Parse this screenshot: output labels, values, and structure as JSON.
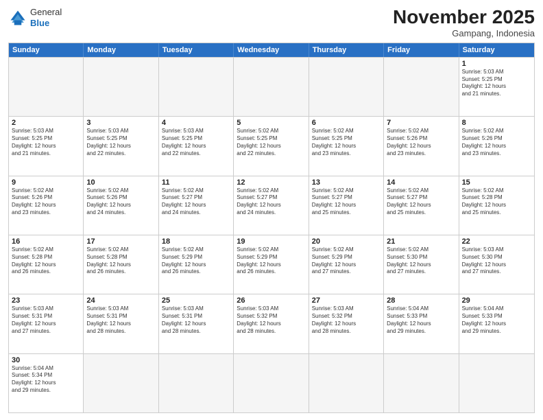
{
  "header": {
    "logo_general": "General",
    "logo_blue": "Blue",
    "month_title": "November 2025",
    "location": "Gampang, Indonesia"
  },
  "weekdays": [
    "Sunday",
    "Monday",
    "Tuesday",
    "Wednesday",
    "Thursday",
    "Friday",
    "Saturday"
  ],
  "rows": [
    [
      {
        "day": "",
        "text": ""
      },
      {
        "day": "",
        "text": ""
      },
      {
        "day": "",
        "text": ""
      },
      {
        "day": "",
        "text": ""
      },
      {
        "day": "",
        "text": ""
      },
      {
        "day": "",
        "text": ""
      },
      {
        "day": "1",
        "text": "Sunrise: 5:03 AM\nSunset: 5:25 PM\nDaylight: 12 hours\nand 21 minutes."
      }
    ],
    [
      {
        "day": "2",
        "text": "Sunrise: 5:03 AM\nSunset: 5:25 PM\nDaylight: 12 hours\nand 21 minutes."
      },
      {
        "day": "3",
        "text": "Sunrise: 5:03 AM\nSunset: 5:25 PM\nDaylight: 12 hours\nand 22 minutes."
      },
      {
        "day": "4",
        "text": "Sunrise: 5:03 AM\nSunset: 5:25 PM\nDaylight: 12 hours\nand 22 minutes."
      },
      {
        "day": "5",
        "text": "Sunrise: 5:02 AM\nSunset: 5:25 PM\nDaylight: 12 hours\nand 22 minutes."
      },
      {
        "day": "6",
        "text": "Sunrise: 5:02 AM\nSunset: 5:25 PM\nDaylight: 12 hours\nand 23 minutes."
      },
      {
        "day": "7",
        "text": "Sunrise: 5:02 AM\nSunset: 5:26 PM\nDaylight: 12 hours\nand 23 minutes."
      },
      {
        "day": "8",
        "text": "Sunrise: 5:02 AM\nSunset: 5:26 PM\nDaylight: 12 hours\nand 23 minutes."
      }
    ],
    [
      {
        "day": "9",
        "text": "Sunrise: 5:02 AM\nSunset: 5:26 PM\nDaylight: 12 hours\nand 23 minutes."
      },
      {
        "day": "10",
        "text": "Sunrise: 5:02 AM\nSunset: 5:26 PM\nDaylight: 12 hours\nand 24 minutes."
      },
      {
        "day": "11",
        "text": "Sunrise: 5:02 AM\nSunset: 5:27 PM\nDaylight: 12 hours\nand 24 minutes."
      },
      {
        "day": "12",
        "text": "Sunrise: 5:02 AM\nSunset: 5:27 PM\nDaylight: 12 hours\nand 24 minutes."
      },
      {
        "day": "13",
        "text": "Sunrise: 5:02 AM\nSunset: 5:27 PM\nDaylight: 12 hours\nand 25 minutes."
      },
      {
        "day": "14",
        "text": "Sunrise: 5:02 AM\nSunset: 5:27 PM\nDaylight: 12 hours\nand 25 minutes."
      },
      {
        "day": "15",
        "text": "Sunrise: 5:02 AM\nSunset: 5:28 PM\nDaylight: 12 hours\nand 25 minutes."
      }
    ],
    [
      {
        "day": "16",
        "text": "Sunrise: 5:02 AM\nSunset: 5:28 PM\nDaylight: 12 hours\nand 26 minutes."
      },
      {
        "day": "17",
        "text": "Sunrise: 5:02 AM\nSunset: 5:28 PM\nDaylight: 12 hours\nand 26 minutes."
      },
      {
        "day": "18",
        "text": "Sunrise: 5:02 AM\nSunset: 5:29 PM\nDaylight: 12 hours\nand 26 minutes."
      },
      {
        "day": "19",
        "text": "Sunrise: 5:02 AM\nSunset: 5:29 PM\nDaylight: 12 hours\nand 26 minutes."
      },
      {
        "day": "20",
        "text": "Sunrise: 5:02 AM\nSunset: 5:29 PM\nDaylight: 12 hours\nand 27 minutes."
      },
      {
        "day": "21",
        "text": "Sunrise: 5:02 AM\nSunset: 5:30 PM\nDaylight: 12 hours\nand 27 minutes."
      },
      {
        "day": "22",
        "text": "Sunrise: 5:03 AM\nSunset: 5:30 PM\nDaylight: 12 hours\nand 27 minutes."
      }
    ],
    [
      {
        "day": "23",
        "text": "Sunrise: 5:03 AM\nSunset: 5:31 PM\nDaylight: 12 hours\nand 27 minutes."
      },
      {
        "day": "24",
        "text": "Sunrise: 5:03 AM\nSunset: 5:31 PM\nDaylight: 12 hours\nand 28 minutes."
      },
      {
        "day": "25",
        "text": "Sunrise: 5:03 AM\nSunset: 5:31 PM\nDaylight: 12 hours\nand 28 minutes."
      },
      {
        "day": "26",
        "text": "Sunrise: 5:03 AM\nSunset: 5:32 PM\nDaylight: 12 hours\nand 28 minutes."
      },
      {
        "day": "27",
        "text": "Sunrise: 5:03 AM\nSunset: 5:32 PM\nDaylight: 12 hours\nand 28 minutes."
      },
      {
        "day": "28",
        "text": "Sunrise: 5:04 AM\nSunset: 5:33 PM\nDaylight: 12 hours\nand 29 minutes."
      },
      {
        "day": "29",
        "text": "Sunrise: 5:04 AM\nSunset: 5:33 PM\nDaylight: 12 hours\nand 29 minutes."
      }
    ],
    [
      {
        "day": "30",
        "text": "Sunrise: 5:04 AM\nSunset: 5:34 PM\nDaylight: 12 hours\nand 29 minutes."
      },
      {
        "day": "",
        "text": ""
      },
      {
        "day": "",
        "text": ""
      },
      {
        "day": "",
        "text": ""
      },
      {
        "day": "",
        "text": ""
      },
      {
        "day": "",
        "text": ""
      },
      {
        "day": "",
        "text": ""
      }
    ]
  ]
}
